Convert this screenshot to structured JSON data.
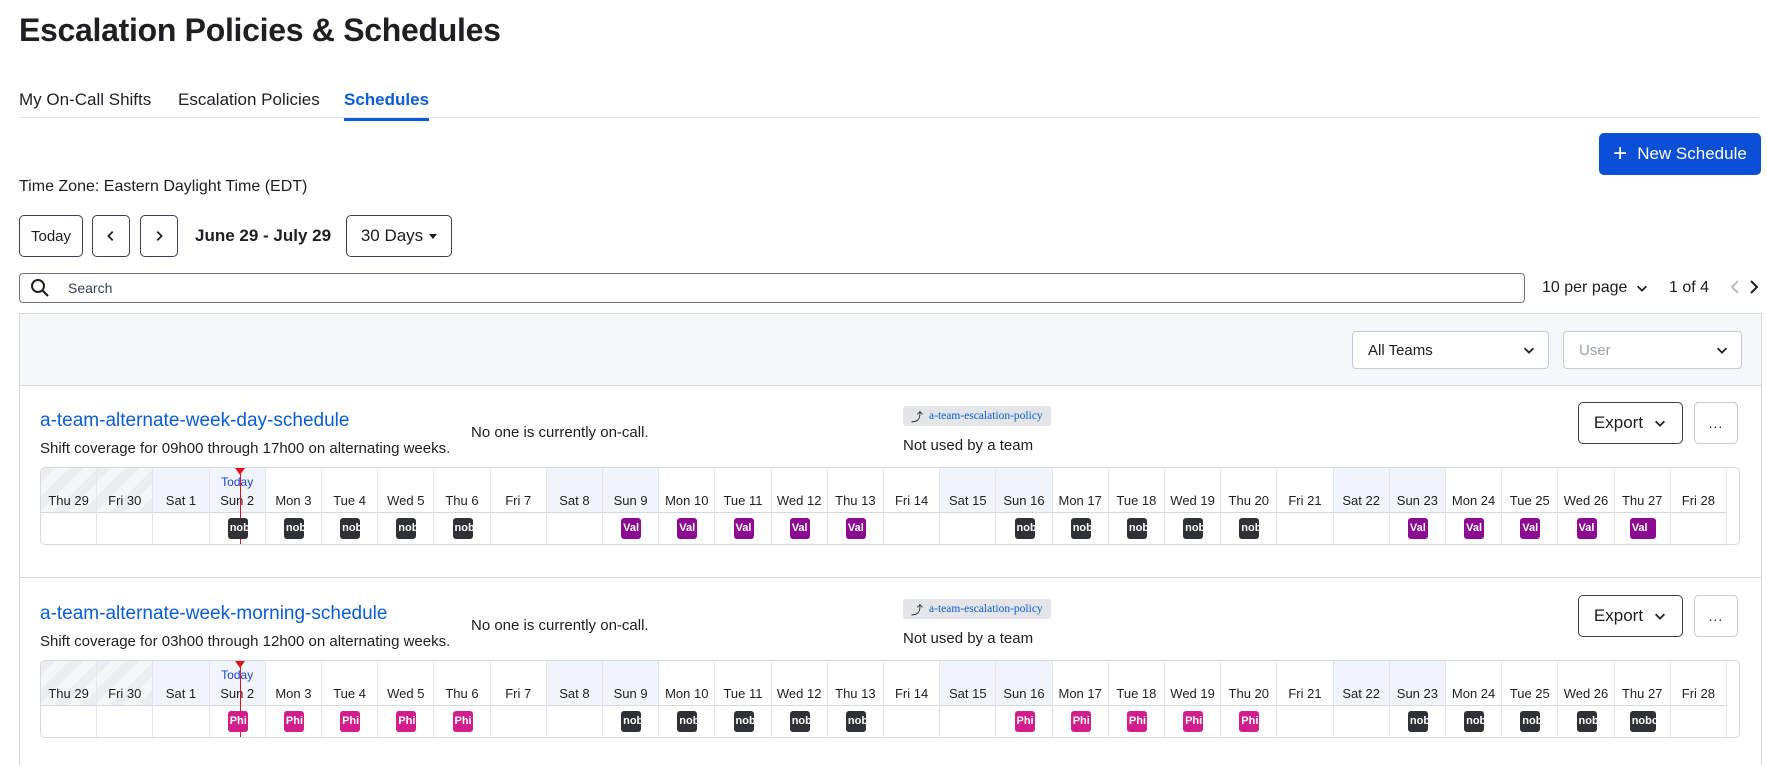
{
  "page": {
    "title": "Escalation Policies & Schedules"
  },
  "tabs": [
    {
      "label": "My On-Call Shifts",
      "active": false
    },
    {
      "label": "Escalation Policies",
      "active": false
    },
    {
      "label": "Schedules",
      "active": true
    }
  ],
  "toolbar": {
    "new_schedule_label": "New Schedule",
    "timezone": "Time Zone: Eastern Daylight Time (EDT)",
    "today_label": "Today",
    "date_range": "June 29 - July 29",
    "range_select": "30 Days"
  },
  "search": {
    "placeholder": "Search"
  },
  "pagination": {
    "per_page": "10 per page",
    "page_status": "1 of 4"
  },
  "filters": {
    "team": "All Teams",
    "user_placeholder": "User"
  },
  "colors": {
    "accent": "#0b4fd6",
    "link": "#0b5cd5",
    "today_marker": "#e0101f",
    "shift_dark": "#2f3136",
    "shift_purple": "#8b0a91",
    "shift_pink": "#d21e8a"
  },
  "days": [
    {
      "label": "Thu 29",
      "type": "past"
    },
    {
      "label": "Fri 30",
      "type": "past"
    },
    {
      "label": "Sat 1",
      "type": "weekend"
    },
    {
      "label": "Sun 2",
      "type": "weekend",
      "today": true
    },
    {
      "label": "Mon 3",
      "type": "weekday"
    },
    {
      "label": "Tue 4",
      "type": "weekday"
    },
    {
      "label": "Wed 5",
      "type": "weekday"
    },
    {
      "label": "Thu 6",
      "type": "weekday"
    },
    {
      "label": "Fri 7",
      "type": "weekday"
    },
    {
      "label": "Sat 8",
      "type": "weekend"
    },
    {
      "label": "Sun 9",
      "type": "weekend"
    },
    {
      "label": "Mon 10",
      "type": "weekday"
    },
    {
      "label": "Tue 11",
      "type": "weekday"
    },
    {
      "label": "Wed 12",
      "type": "weekday"
    },
    {
      "label": "Thu 13",
      "type": "weekday"
    },
    {
      "label": "Fri 14",
      "type": "weekday"
    },
    {
      "label": "Sat 15",
      "type": "weekend"
    },
    {
      "label": "Sun 16",
      "type": "weekend"
    },
    {
      "label": "Mon 17",
      "type": "weekday"
    },
    {
      "label": "Tue 18",
      "type": "weekday"
    },
    {
      "label": "Wed 19",
      "type": "weekday"
    },
    {
      "label": "Thu 20",
      "type": "weekday"
    },
    {
      "label": "Fri 21",
      "type": "weekday"
    },
    {
      "label": "Sat 22",
      "type": "weekend"
    },
    {
      "label": "Sun 23",
      "type": "weekend"
    },
    {
      "label": "Mon 24",
      "type": "weekday"
    },
    {
      "label": "Tue 25",
      "type": "weekday"
    },
    {
      "label": "Wed 26",
      "type": "weekday"
    },
    {
      "label": "Thu 27",
      "type": "weekday"
    },
    {
      "label": "Fri 28",
      "type": "weekday"
    }
  ],
  "today_text": "Today",
  "schedules": [
    {
      "name": "a-team-alternate-week-day-schedule",
      "description": "Shift coverage for 09h00 through 17h00 on alternating weeks.",
      "oncall_status": "No one is currently on-call.",
      "policy": "a-team-escalation-policy",
      "team_status": "Not used by a team",
      "export_label": "Export",
      "more_label": "...",
      "shifts": [
        {
          "day": 4,
          "label": "nob",
          "color": "dark"
        },
        {
          "day": 5,
          "label": "nob",
          "color": "dark"
        },
        {
          "day": 6,
          "label": "nob",
          "color": "dark"
        },
        {
          "day": 7,
          "label": "nob",
          "color": "dark"
        },
        {
          "day": 8,
          "label": "nob",
          "color": "dark"
        },
        {
          "day": 11,
          "label": "Val",
          "color": "purple"
        },
        {
          "day": 12,
          "label": "Val",
          "color": "purple"
        },
        {
          "day": 13,
          "label": "Val",
          "color": "purple"
        },
        {
          "day": 14,
          "label": "Val",
          "color": "purple"
        },
        {
          "day": 15,
          "label": "Val",
          "color": "purple"
        },
        {
          "day": 18,
          "label": "nob",
          "color": "dark"
        },
        {
          "day": 19,
          "label": "nob",
          "color": "dark"
        },
        {
          "day": 20,
          "label": "nob",
          "color": "dark"
        },
        {
          "day": 21,
          "label": "nob",
          "color": "dark"
        },
        {
          "day": 22,
          "label": "nob",
          "color": "dark"
        },
        {
          "day": 25,
          "label": "Val",
          "color": "purple"
        },
        {
          "day": 26,
          "label": "Val",
          "color": "purple"
        },
        {
          "day": 27,
          "label": "Val",
          "color": "purple"
        },
        {
          "day": 28,
          "label": "Val",
          "color": "purple"
        },
        {
          "day": 29,
          "label": "Val",
          "color": "purple",
          "wide": true
        }
      ]
    },
    {
      "name": "a-team-alternate-week-morning-schedule",
      "description": "Shift coverage for 03h00 through 12h00 on alternating weeks.",
      "oncall_status": "No one is currently on-call.",
      "policy": "a-team-escalation-policy",
      "team_status": "Not used by a team",
      "export_label": "Export",
      "more_label": "...",
      "shifts": [
        {
          "day": 4,
          "label": "Phi",
          "color": "pink"
        },
        {
          "day": 5,
          "label": "Phi",
          "color": "pink"
        },
        {
          "day": 6,
          "label": "Phi",
          "color": "pink"
        },
        {
          "day": 7,
          "label": "Phi",
          "color": "pink"
        },
        {
          "day": 8,
          "label": "Phi",
          "color": "pink"
        },
        {
          "day": 11,
          "label": "nob",
          "color": "dark"
        },
        {
          "day": 12,
          "label": "nob",
          "color": "dark"
        },
        {
          "day": 13,
          "label": "nob",
          "color": "dark"
        },
        {
          "day": 14,
          "label": "nob",
          "color": "dark"
        },
        {
          "day": 15,
          "label": "nob",
          "color": "dark"
        },
        {
          "day": 18,
          "label": "Phi",
          "color": "pink"
        },
        {
          "day": 19,
          "label": "Phi",
          "color": "pink"
        },
        {
          "day": 20,
          "label": "Phi",
          "color": "pink"
        },
        {
          "day": 21,
          "label": "Phi",
          "color": "pink"
        },
        {
          "day": 22,
          "label": "Phi",
          "color": "pink"
        },
        {
          "day": 25,
          "label": "nob",
          "color": "dark"
        },
        {
          "day": 26,
          "label": "nob",
          "color": "dark"
        },
        {
          "day": 27,
          "label": "nob",
          "color": "dark"
        },
        {
          "day": 28,
          "label": "nob",
          "color": "dark"
        },
        {
          "day": 29,
          "label": "nobo",
          "color": "dark",
          "wide": true
        }
      ]
    }
  ]
}
